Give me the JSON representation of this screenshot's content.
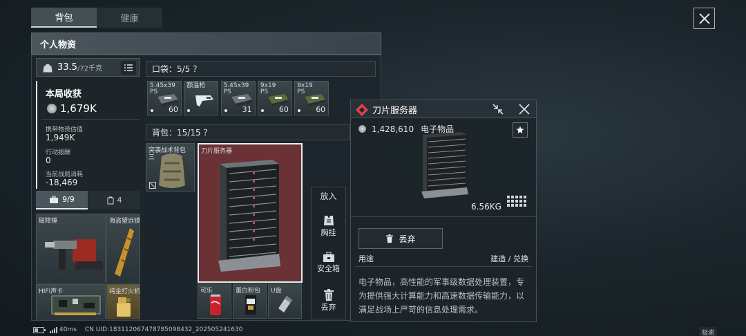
{
  "tabs": [
    {
      "label": "背包"
    },
    {
      "label": "健康"
    }
  ],
  "section_title": "个人物资",
  "weight": {
    "current": "33.5",
    "max": "/72千克"
  },
  "harvest": {
    "title": "本局收获",
    "value": "1,679K",
    "carried_label": "携带物资估值",
    "carried_value": "1,949K",
    "action_label": "行动报酬",
    "action_value": "0",
    "cost_label": "当前战局消耗",
    "cost_value": "-18,469"
  },
  "counters": {
    "case": "9/9",
    "other": "4"
  },
  "pocket": {
    "title": "口袋：5/5 ？"
  },
  "pocket_items": [
    {
      "label": "5.45x39 PS",
      "count": "60",
      "color": "#6f7478"
    },
    {
      "label": "额温枪",
      "count": "",
      "color": "#2c5a74"
    },
    {
      "label": "5.45x39 PS",
      "count": "31",
      "color": "#6f7478"
    },
    {
      "label": "9x19 PS",
      "count": "60",
      "color": "#5d6a3c"
    },
    {
      "label": "9x19 PS",
      "count": "60",
      "color": "#5d6a3c"
    }
  ],
  "backpack": {
    "title": "背包：15/15 ？"
  },
  "backpack_items": [
    {
      "label": "突袭战术背包"
    },
    {
      "label": "刀片服务器"
    },
    {
      "label": "可乐"
    },
    {
      "label": "蛋白粉包"
    },
    {
      "label": "U盘"
    }
  ],
  "case_items": [
    {
      "label": "破障锤"
    },
    {
      "label": "海盗望远镜"
    },
    {
      "label": "HIFI声卡"
    },
    {
      "label": "纯金打火机"
    }
  ],
  "side_actions": {
    "title": "放入",
    "chest": "胸挂",
    "safe": "安全箱",
    "discard": "丢弃"
  },
  "detail": {
    "name": "刀片服务器",
    "price": "1,428,610",
    "category": "电子物品",
    "weight": "6.56KG",
    "discard_label": "丢弃",
    "usage_label": "用途",
    "usage_value": "建造 / 兑换",
    "description": "电子物品，高性能的军事级数据处理装置，专为提供强大计算能力和高速数据传输能力，以满足战场上严苛的信息处理需求。"
  },
  "status": {
    "ping": "40ms",
    "uid": "CN UID:18311206747878509843​2_202505241630",
    "corner": "极速"
  },
  "colors": {
    "accent_red": "#e0414a",
    "server_bg": "#6b3236"
  }
}
